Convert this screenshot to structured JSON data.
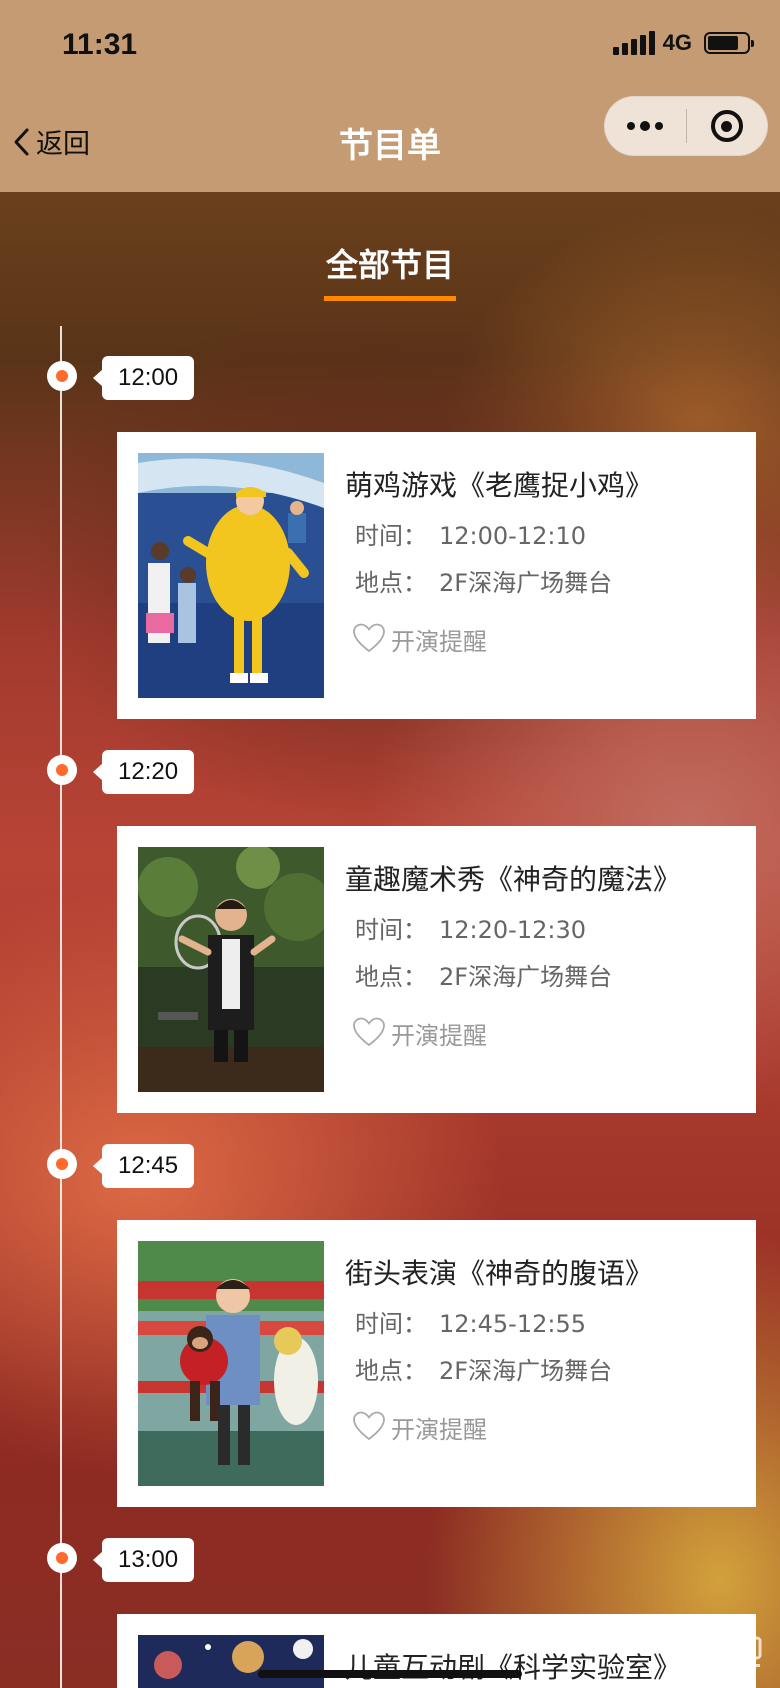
{
  "status_bar": {
    "time": "11:31",
    "network": "4G",
    "battery_level": 0.8
  },
  "nav": {
    "back_label": "返回",
    "title": "节目单"
  },
  "tab": {
    "label": "全部节目"
  },
  "accent_color": "#ff8a00",
  "dot_color": "#ff6a2a",
  "reminder_label": "开演提醒",
  "time_key": "时间：",
  "place_key": "地点：",
  "slots": [
    {
      "time": "12:00",
      "title": "萌鸡游戏《老鹰捉小鸡》",
      "time_range": "12:00-12:10",
      "location": "2F深海广场舞台",
      "thumb_icon": "chick-costume-performer"
    },
    {
      "time": "12:20",
      "title": "童趣魔术秀《神奇的魔法》",
      "time_range": "12:20-12:30",
      "location": "2F深海广场舞台",
      "thumb_icon": "magician-performer"
    },
    {
      "time": "12:45",
      "title": "街头表演《神奇的腹语》",
      "time_range": "12:45-12:55",
      "location": "2F深海广场舞台",
      "thumb_icon": "ventriloquist-performer"
    },
    {
      "time": "13:00",
      "title": "儿童互动剧《科学实验室》",
      "thumb_icon": "science-show-stage"
    }
  ]
}
